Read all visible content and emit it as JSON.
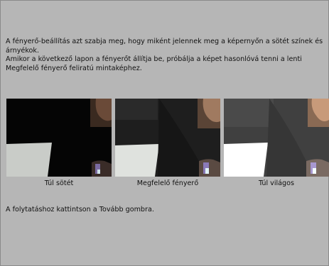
{
  "intro": {
    "line1": "A fényerő-beállítás azt szabja meg, hogy miként jelennek meg a képernyőn a sötét színek és árnyékok.",
    "line2": "Amikor a következő lapon a fényerőt állítja be, próbálja a képet hasonlóvá tenni a lenti Megfelelő fényerő feliratú mintaképhez."
  },
  "samples": [
    {
      "caption": "Túl sötét"
    },
    {
      "caption": "Megfelelő fényerő"
    },
    {
      "caption": "Túl világos"
    }
  ],
  "footer": "A folytatáshoz kattintson a Tovább gombra."
}
